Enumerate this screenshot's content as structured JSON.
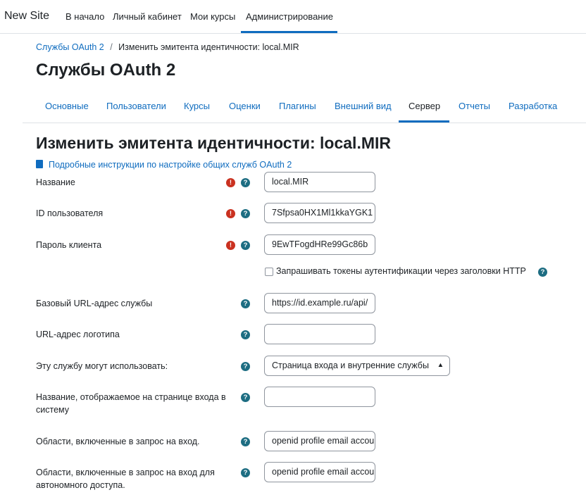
{
  "topnav": {
    "brand": "New Site",
    "items": [
      "В начало",
      "Личный кабинет",
      "Мои курсы",
      "Администрирование"
    ],
    "active": "Администрирование"
  },
  "breadcrumb": {
    "link": "Службы OAuth 2",
    "separator": "/",
    "current": "Изменить эмитента идентичности: local.MIR"
  },
  "page_title": "Службы OAuth 2",
  "tabs": [
    "Основные",
    "Пользователи",
    "Курсы",
    "Оценки",
    "Плагины",
    "Внешний вид",
    "Сервер",
    "Отчеты",
    "Разработка"
  ],
  "active_tab": "Сервер",
  "form": {
    "heading": "Изменить эмитента идентичности: local.MIR",
    "doc_link": "Подробные инструкции по настройке общих служб OAuth 2",
    "fields": [
      {
        "label": "Название",
        "value": "local.MIR",
        "required": true
      },
      {
        "label": "ID пользователя",
        "value": "7Sfpsa0HX1Ml1kkaYGK1",
        "required": true
      },
      {
        "label": "Пароль клиента",
        "value": "9EwTFogdHRe99Gc86b",
        "required": true
      },
      {
        "label": "Базовый URL-адрес службы",
        "value": "https://id.example.ru/api/"
      },
      {
        "label": "URL-адрес логотипа",
        "value": ""
      },
      {
        "label": "Эту службу могут использовать:",
        "value": "Страница входа и внутренние службы"
      },
      {
        "label": "Название, отображаемое на странице входа в систему",
        "value": ""
      },
      {
        "label": "Области, включенные в запрос на вход.",
        "value": "openid profile email accounts"
      },
      {
        "label": "Области, включенные в запрос на вход для автономного доступа.",
        "value": "openid profile email accounts"
      }
    ],
    "checkbox": {
      "label": "Запрашивать токены аутентификации через заголовки HTTP",
      "checked": false
    }
  },
  "icons": {
    "required": "!",
    "help": "?"
  },
  "colors": {
    "accent": "#0f6cbf",
    "required": "#ca3120",
    "help": "#1d6d82"
  }
}
